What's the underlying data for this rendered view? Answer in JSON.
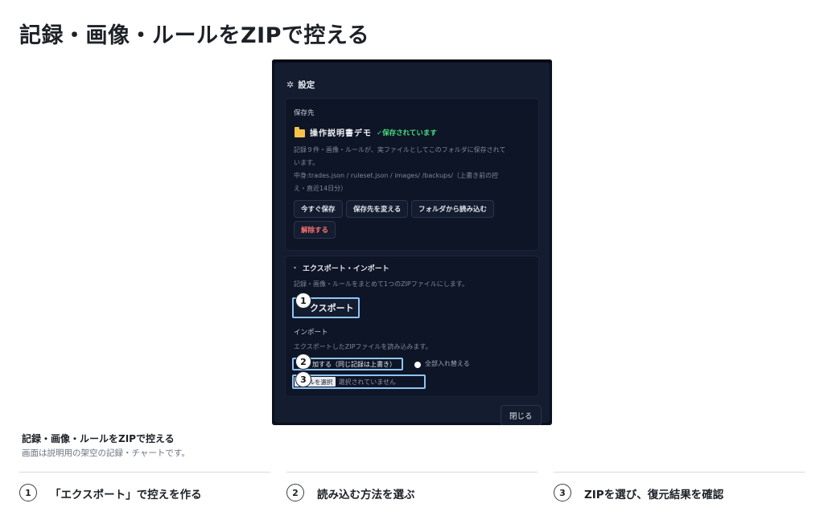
{
  "page": {
    "title": "記録・画像・ルールをZIPで控える"
  },
  "dialog": {
    "title": "設定",
    "storage": {
      "section_label": "保存先",
      "folder_name": "操作説明書デモ",
      "saved_status": "✓保存されています",
      "desc_line1": "記録９件・画像・ルールが、実ファイルとしてこのフォルダに保存されて",
      "desc_line2": "います。",
      "contents_line1": "中身:trades.json / ruleset.json / images/ /backups/（上書き前の控",
      "contents_line2": "え・直近14日分）",
      "buttons": {
        "save_now": "今すぐ保存",
        "change_location": "保存先を変える",
        "load_from_folder": "フォルダから読み込む",
        "release": "解除する"
      }
    },
    "export_import": {
      "title": "エクスポート・インポート",
      "export_desc": "記録・画像・ルールをまとめて1つのZIPファイルにします。",
      "export_button": "エクスポート",
      "export_button_visible": "クスポート",
      "import_label": "インポート",
      "import_desc": "エクスポートしたZIPファイルを読み込みます。",
      "option_merge": "追加する（同じ記録は上書き）",
      "option_merge_visible": "加する（同じ記録は上書き）",
      "option_replace": "全部入れ替える",
      "file_button": "ファイルを選択",
      "file_button_visible": "イルを選択",
      "file_status": "選択されていません"
    },
    "close_button": "閉じる"
  },
  "badges": [
    "1",
    "2",
    "3"
  ],
  "caption": {
    "title": "記録・画像・ルールをZIPで控える",
    "subtitle": "画面は説明用の架空の記録・チャートです。"
  },
  "steps": [
    {
      "num": "1",
      "label": "「エクスポート」で控えを作る"
    },
    {
      "num": "2",
      "label": "読み込む方法を選ぶ"
    },
    {
      "num": "3",
      "label": "ZIPを選び、復元結果を確認"
    }
  ],
  "colors": {
    "accent_highlight": "#8fc5f5",
    "saved_green": "#4ade80",
    "danger_red": "#f87171",
    "folder_yellow": "#f4c24b",
    "dialog_bg": "#141c2f"
  }
}
